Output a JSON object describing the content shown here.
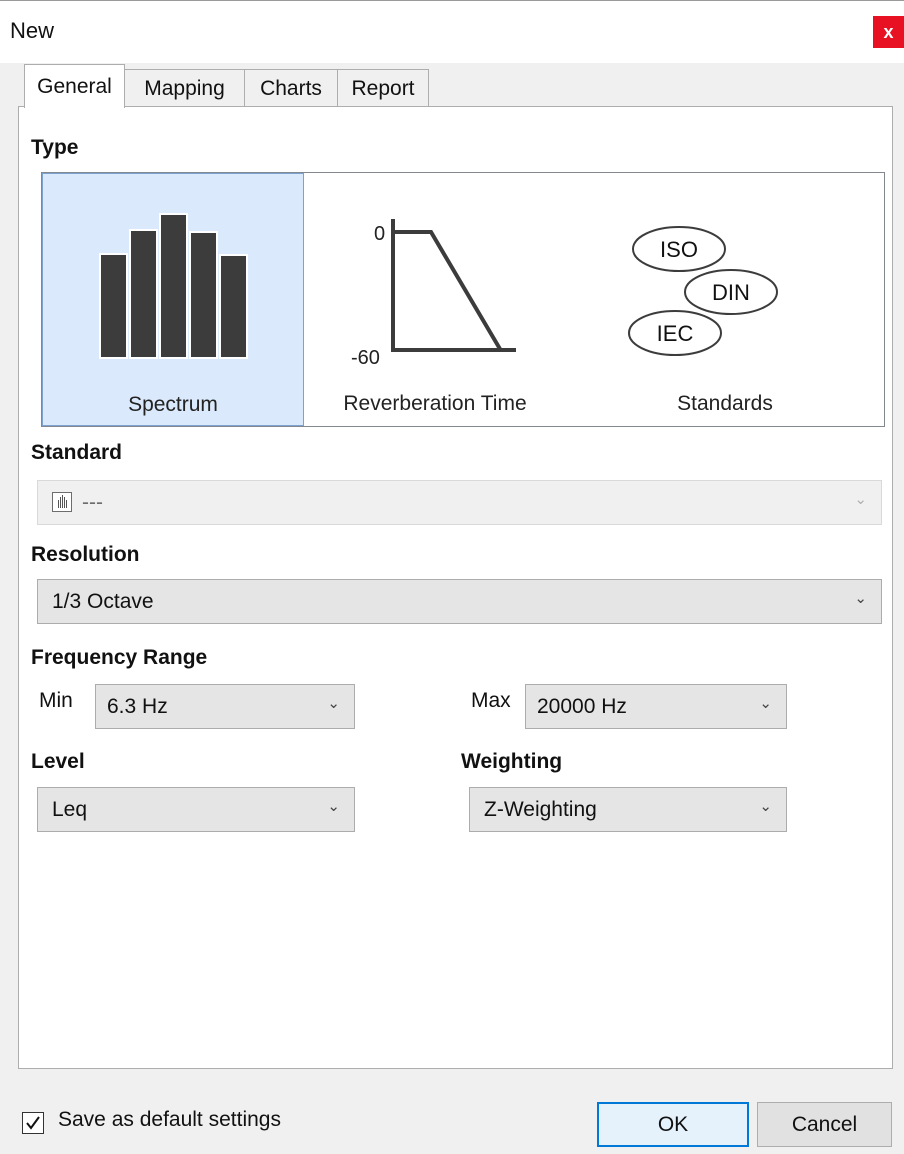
{
  "window": {
    "title": "New",
    "close_glyph": "x"
  },
  "tabs": [
    {
      "label": "General",
      "active": true
    },
    {
      "label": "Mapping",
      "active": false
    },
    {
      "label": "Charts",
      "active": false
    },
    {
      "label": "Report",
      "active": false
    }
  ],
  "type_section": {
    "label": "Type",
    "items": [
      {
        "label": "Spectrum",
        "selected": true,
        "icon": "spectrum-bars-icon"
      },
      {
        "label": "Reverberation Time",
        "selected": false,
        "icon": "reverberation-curve-icon",
        "axis_top": "0",
        "axis_bottom": "-60"
      },
      {
        "label": "Standards",
        "selected": false,
        "icon": "standards-icon",
        "badges": [
          "ISO",
          "DIN",
          "IEC"
        ]
      }
    ]
  },
  "standard": {
    "label": "Standard",
    "value": "---",
    "disabled": true,
    "icon": "spectrum-small-icon"
  },
  "resolution": {
    "label": "Resolution",
    "value": "1/3 Octave"
  },
  "frequency_range": {
    "label": "Frequency Range",
    "min_label": "Min",
    "min_value": "6.3 Hz",
    "max_label": "Max",
    "max_value": "20000 Hz"
  },
  "level": {
    "label": "Level",
    "value": "Leq"
  },
  "weighting": {
    "label": "Weighting",
    "value": "Z-Weighting"
  },
  "footer": {
    "save_default_label": "Save as default settings",
    "save_default_checked": true,
    "ok_label": "OK",
    "cancel_label": "Cancel"
  },
  "colors": {
    "selection_bg": "#dbe9fc",
    "selection_border": "#7da2ce",
    "close_red": "#e81123",
    "default_button_border": "#0078d7"
  }
}
